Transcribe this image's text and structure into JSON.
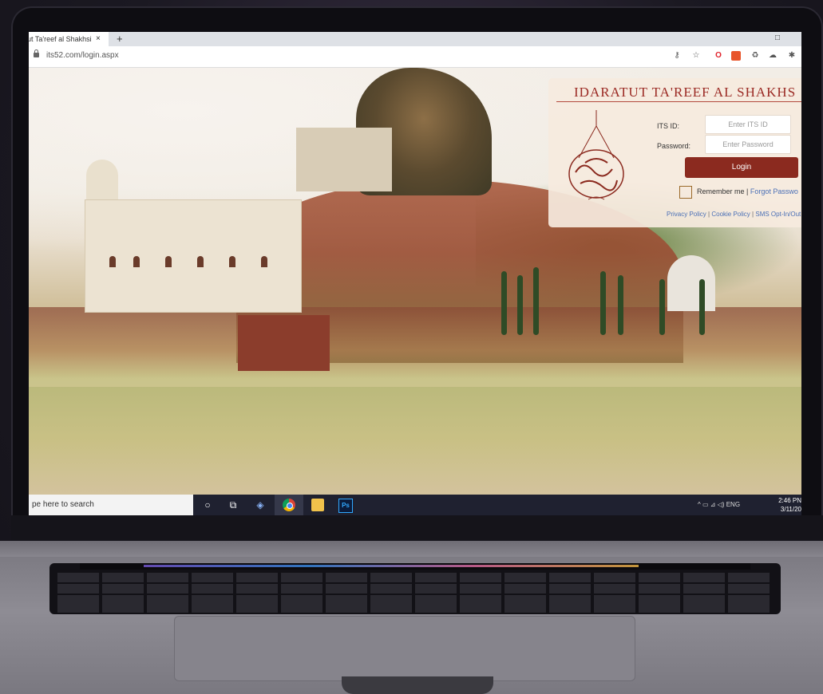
{
  "browser": {
    "tab_title": "ut Ta'reef al Shakhsi",
    "tab_close": "×",
    "new_tab": "+",
    "url": "its52.com/login.aspx",
    "window_min": "□"
  },
  "extensions": [
    "key-icon",
    "star-icon",
    "opera-icon",
    "extension-red-icon",
    "recycle-icon",
    "cloud-icon",
    "puzzle-icon"
  ],
  "login": {
    "title": "IDARATUT TA'REEF AL SHAKHS",
    "its_id_label": "ITS ID:",
    "its_id_placeholder": "Enter ITS ID",
    "password_label": "Password:",
    "password_placeholder": "Enter Password",
    "login_button": "Login",
    "remember_me": "Remember me",
    "separator": "|",
    "forgot_password": "Forgot Passwo",
    "links": [
      "Privacy Policy",
      "Cookie Policy",
      "SMS Opt-In/Out"
    ]
  },
  "taskbar": {
    "search_text": "pe here to search",
    "tray_text": "^ ▭ ⊿ ◁) ENG",
    "time": "2:46 PN",
    "date": "3/11/20"
  },
  "colors": {
    "brand_red": "#8b2a1f",
    "title_red": "#9b2a24",
    "link_blue": "#4a6fb6",
    "taskbar": "#1f2130"
  }
}
